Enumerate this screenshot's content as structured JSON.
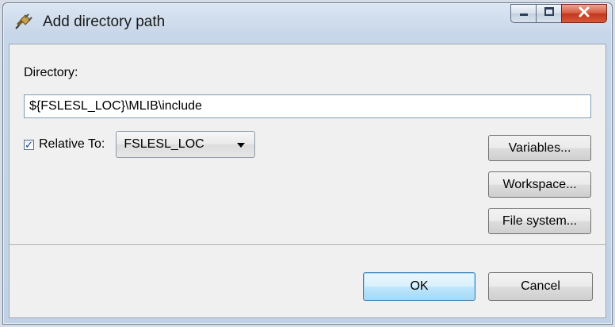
{
  "window": {
    "title": "Add directory path",
    "app_icon": "eclipse-plug-icon"
  },
  "caption_buttons": {
    "minimize_icon": "minimize-icon",
    "maximize_icon": "maximize-icon",
    "close_icon": "close-icon",
    "close_color": "#c7381c"
  },
  "form": {
    "directory_label": "Directory:",
    "directory_value": "${FSLESL_LOC}\\MLIB\\include",
    "relative_checked": true,
    "relative_label": "Relative To:",
    "relative_selected": "FSLESL_LOC"
  },
  "side_buttons": {
    "variables": "Variables...",
    "workspace": "Workspace...",
    "file_system": "File system..."
  },
  "footer": {
    "ok": "OK",
    "cancel": "Cancel"
  }
}
